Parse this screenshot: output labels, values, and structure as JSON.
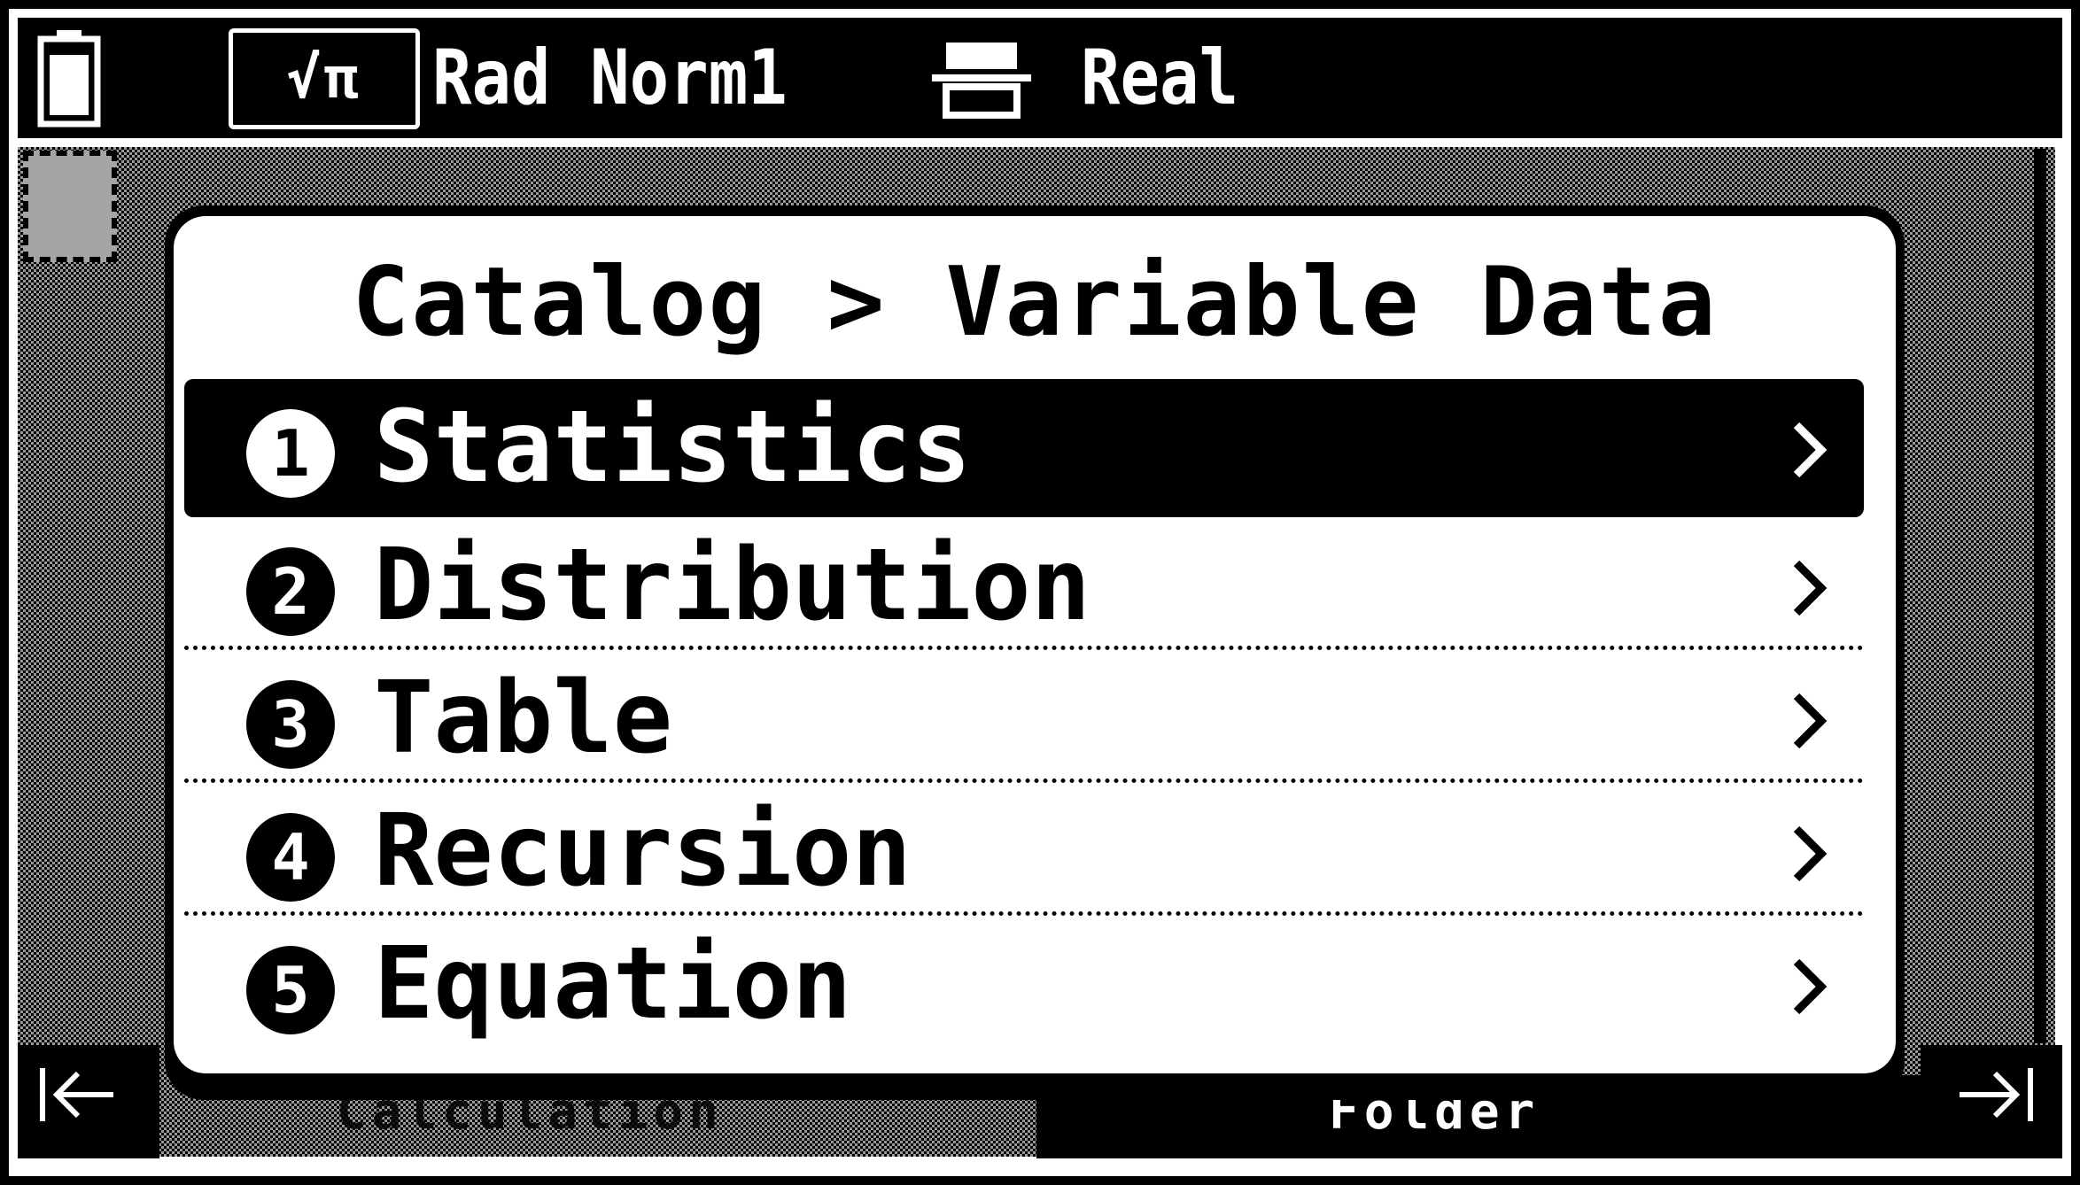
{
  "status_bar": {
    "battery_icon": "battery-full-icon",
    "calc_mode": "√π",
    "angle_format": "Rad Norm1",
    "printer_icon": "printer-icon",
    "number_mode": "Real"
  },
  "dialog": {
    "title": "Catalog > Variable Data",
    "items": [
      {
        "number": "1",
        "label": "Statistics",
        "selected": true
      },
      {
        "number": "2",
        "label": "Distribution",
        "selected": false
      },
      {
        "number": "3",
        "label": "Table",
        "selected": false
      },
      {
        "number": "4",
        "label": "Recursion",
        "selected": false
      },
      {
        "number": "5",
        "label": "Equation",
        "selected": false
      }
    ]
  },
  "bottom_bar": {
    "left_icon": "arrow-to-left-edge-icon",
    "right_icon": "arrow-to-right-edge-icon",
    "left_hidden_text": "Calculation",
    "right_hidden_text": "Folder"
  },
  "colors": {
    "foreground": "#000000",
    "background": "#ffffff"
  }
}
